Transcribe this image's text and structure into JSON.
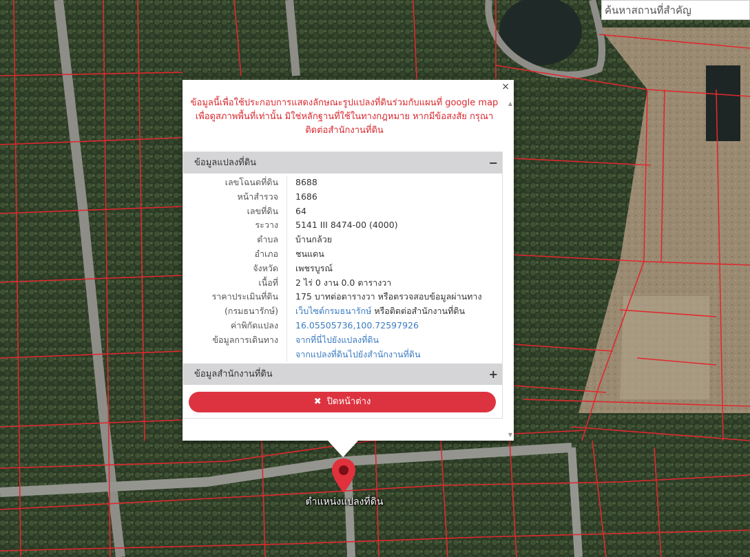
{
  "search": {
    "placeholder": "ค้นหาสถานที่สำคัญ"
  },
  "popup": {
    "close_symbol": "×",
    "notice_lines": [
      "ข้อมูลนี้เพื่อใช้ประกอบการแสดงลักษณะรูปแปลงที่ดินร่วมกับแผนที่ google map",
      "เพื่อดูสภาพพื้นที่เท่านั้น มิใช่หลักฐานที่ใช้ในทางกฎหมาย หากมีข้อสงสัย กรุณา",
      "ติดต่อสำนักงานที่ดิน"
    ],
    "parcel_section": {
      "title": "ข้อมูลแปลงที่ดิน",
      "toggle": "−",
      "rows": [
        {
          "label": "เลขโฉนดที่ดิน",
          "value": "8688"
        },
        {
          "label": "หน้าสำรวจ",
          "value": "1686"
        },
        {
          "label": "เลขที่ดิน",
          "value": "64"
        },
        {
          "label": "ระวาง",
          "value": "5141 III 8474-00 (4000)"
        },
        {
          "label": "ตำบล",
          "value": "บ้านกล้วย"
        },
        {
          "label": "อำเภอ",
          "value": "ชนแดน"
        },
        {
          "label": "จังหวัด",
          "value": "เพชรบูรณ์"
        },
        {
          "label": "เนื้อที่",
          "value": "2 ไร่ 0 งาน 0.0 ตารางวา"
        },
        {
          "label": "ราคาประเมินที่ดิน",
          "value": "175 บาทต่อตารางวา หรือตรวจสอบข้อมูลผ่านทาง"
        }
      ],
      "treasury_label": "(กรมธนารักษ์)",
      "treasury_link": "เว็บไซต์กรมธนารักษ์",
      "treasury_suffix": " หรือติดต่อสำนักงานที่ดิน",
      "coord_label": "ค่าพิกัดแปลง",
      "coord_value": "16.05505736,100.72597926",
      "travel_label": "ข้อมูลการเดินทาง",
      "travel_link_1": "จากที่นี่ไปยังแปลงที่ดิน",
      "travel_link_2": "จากแปลงที่ดินไปยังสำนักงานที่ดิน"
    },
    "office_section": {
      "title": "ข้อมูลสำนักงานที่ดิน",
      "toggle": "+"
    },
    "close_button": {
      "icon": "✖",
      "label": "ปิดหน้าต่าง"
    }
  },
  "marker": {
    "label": "ตำแหน่งแปลงที่ดิน",
    "color": "#e0313c"
  },
  "colors": {
    "parcel_lines": "#e0282e",
    "accent": "#dd3340",
    "link": "#3b7bc0"
  }
}
